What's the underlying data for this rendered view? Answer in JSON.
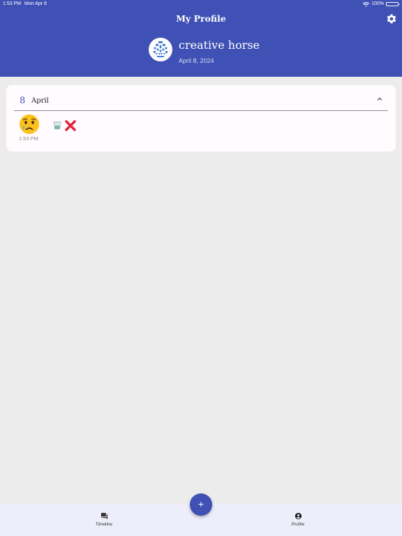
{
  "status_bar": {
    "time": "1:53 PM",
    "date": "Mon Apr 8",
    "battery": "100%"
  },
  "header": {
    "title": "My Profile",
    "settings_icon": "gear-icon"
  },
  "profile": {
    "name": "creative horse",
    "date": "April 8, 2024",
    "avatar_icon": "patterned-avatar"
  },
  "day_card": {
    "day": "8",
    "month": "April",
    "collapse_icon": "chevron-up-icon",
    "entry": {
      "mood_icon": "crying-face-emoji",
      "time": "1:53 PM",
      "activities": [
        "cup-icon",
        "cross-mark-icon"
      ]
    }
  },
  "fab": {
    "label": "+"
  },
  "bottom_nav": {
    "items": [
      {
        "label": "Timeline",
        "icon": "chat-bubbles-icon"
      },
      {
        "label": "Profile",
        "icon": "account-circle-icon"
      }
    ]
  },
  "colors": {
    "primary": "#3f51b5",
    "background": "#ececec",
    "card": "#fffbfe",
    "nav": "#eeeefa"
  }
}
